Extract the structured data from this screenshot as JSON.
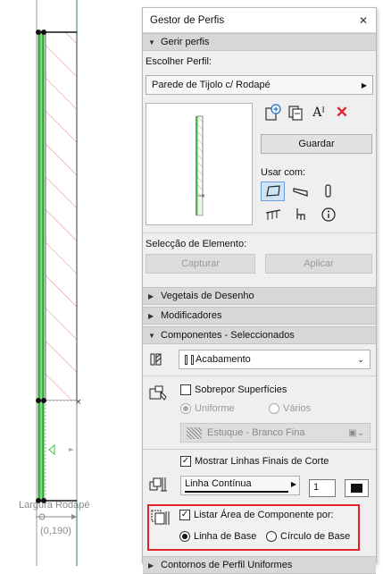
{
  "canvas": {
    "dim_label": "Largura Rodapé",
    "dim_value": "(0,190)"
  },
  "panel": {
    "title": "Gestor de Perfis",
    "sections": {
      "gerir": "Gerir perfis",
      "vegetais": "Vegetais de Desenho",
      "modificadores": "Modificadores",
      "componentes": "Componentes - Seleccionados",
      "contornos": "Contornos de Perfil Uniformes"
    },
    "choose_profile_label": "Escolher Perfil:",
    "profile_value": "Parede de Tijolo c/ Rodapé",
    "save_label": "Guardar",
    "use_with_label": "Usar com:",
    "element_selection_label": "Selecção de Elemento:",
    "capture_label": "Capturar",
    "apply_label": "Aplicar",
    "component_value": "Acabamento",
    "override_surfaces_label": "Sobrepor Superfícies",
    "uniform_label": "Uniforme",
    "various_label": "Vários",
    "surface_value": "Estuque - Branco Fina",
    "show_cut_lines_label": "Mostrar Linhas Finais de Corte",
    "line_type_value": "Linha Contínua",
    "pen_value": "1",
    "list_area_label": "Listar Área de Componente por:",
    "baseline_label": "Linha de Base",
    "circle_label": "Círculo de Base"
  },
  "colors": {
    "accent": "#e1222a",
    "selected_tool": "#cfe3f7",
    "wall_green": "#3fbf3f",
    "hatch": "#e88080"
  },
  "icons": {
    "new_profile": "new-profile-icon",
    "duplicate": "duplicate-icon",
    "rename": "rename-icon",
    "delete": "delete-icon"
  }
}
